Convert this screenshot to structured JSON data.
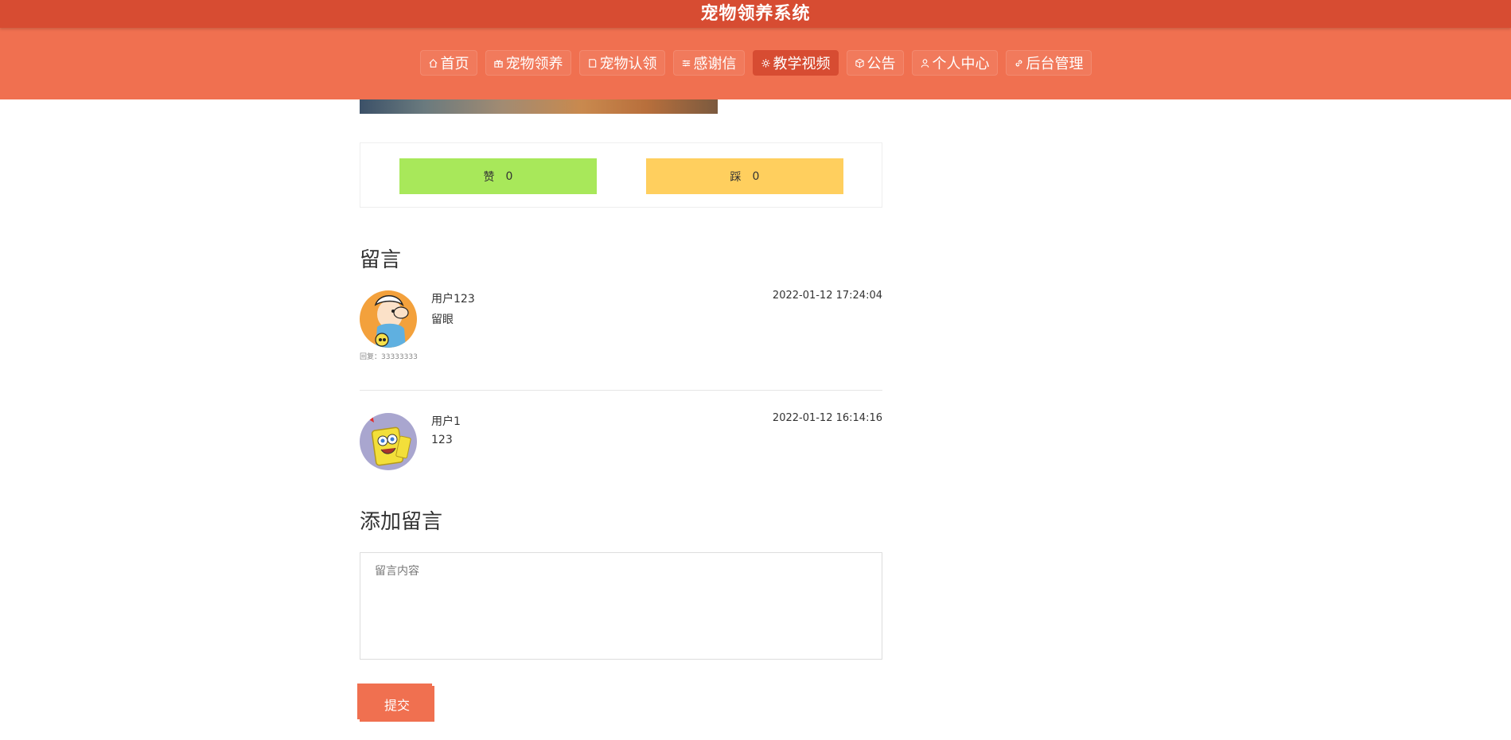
{
  "header": {
    "title": "宠物领养系统"
  },
  "nav": [
    {
      "label": "首页",
      "icon": "home-icon",
      "active": false
    },
    {
      "label": "宠物领养",
      "icon": "gift-icon",
      "active": false
    },
    {
      "label": "宠物认领",
      "icon": "tag-icon",
      "active": false
    },
    {
      "label": "感谢信",
      "icon": "sliders-icon",
      "active": false
    },
    {
      "label": "教学视频",
      "icon": "gear-icon",
      "active": true
    },
    {
      "label": "公告",
      "icon": "box-icon",
      "active": false
    },
    {
      "label": "个人中心",
      "icon": "user-icon",
      "active": false
    },
    {
      "label": "后台管理",
      "icon": "link-icon",
      "active": false
    }
  ],
  "vote": {
    "like_label": "赞",
    "like_count": "0",
    "dislike_label": "踩",
    "dislike_count": "0",
    "like_color": "#a8e85a",
    "dislike_color": "#ffcf5e"
  },
  "comments_title": "留言",
  "comments": [
    {
      "user": "用户123",
      "time": "2022-01-12 17:24:04",
      "text": "留眼",
      "reply": "回复：33333333",
      "avatar": "cartoon-boy-avatar"
    },
    {
      "user": "用户1",
      "time": "2022-01-12 16:14:16",
      "text": "123",
      "avatar": "spongebob-avatar"
    }
  ],
  "add_comment": {
    "title": "添加留言",
    "placeholder": "留言内容",
    "submit_label": "提交"
  },
  "colors": {
    "primary": "#f07050",
    "primary_dark": "#d74c32"
  }
}
